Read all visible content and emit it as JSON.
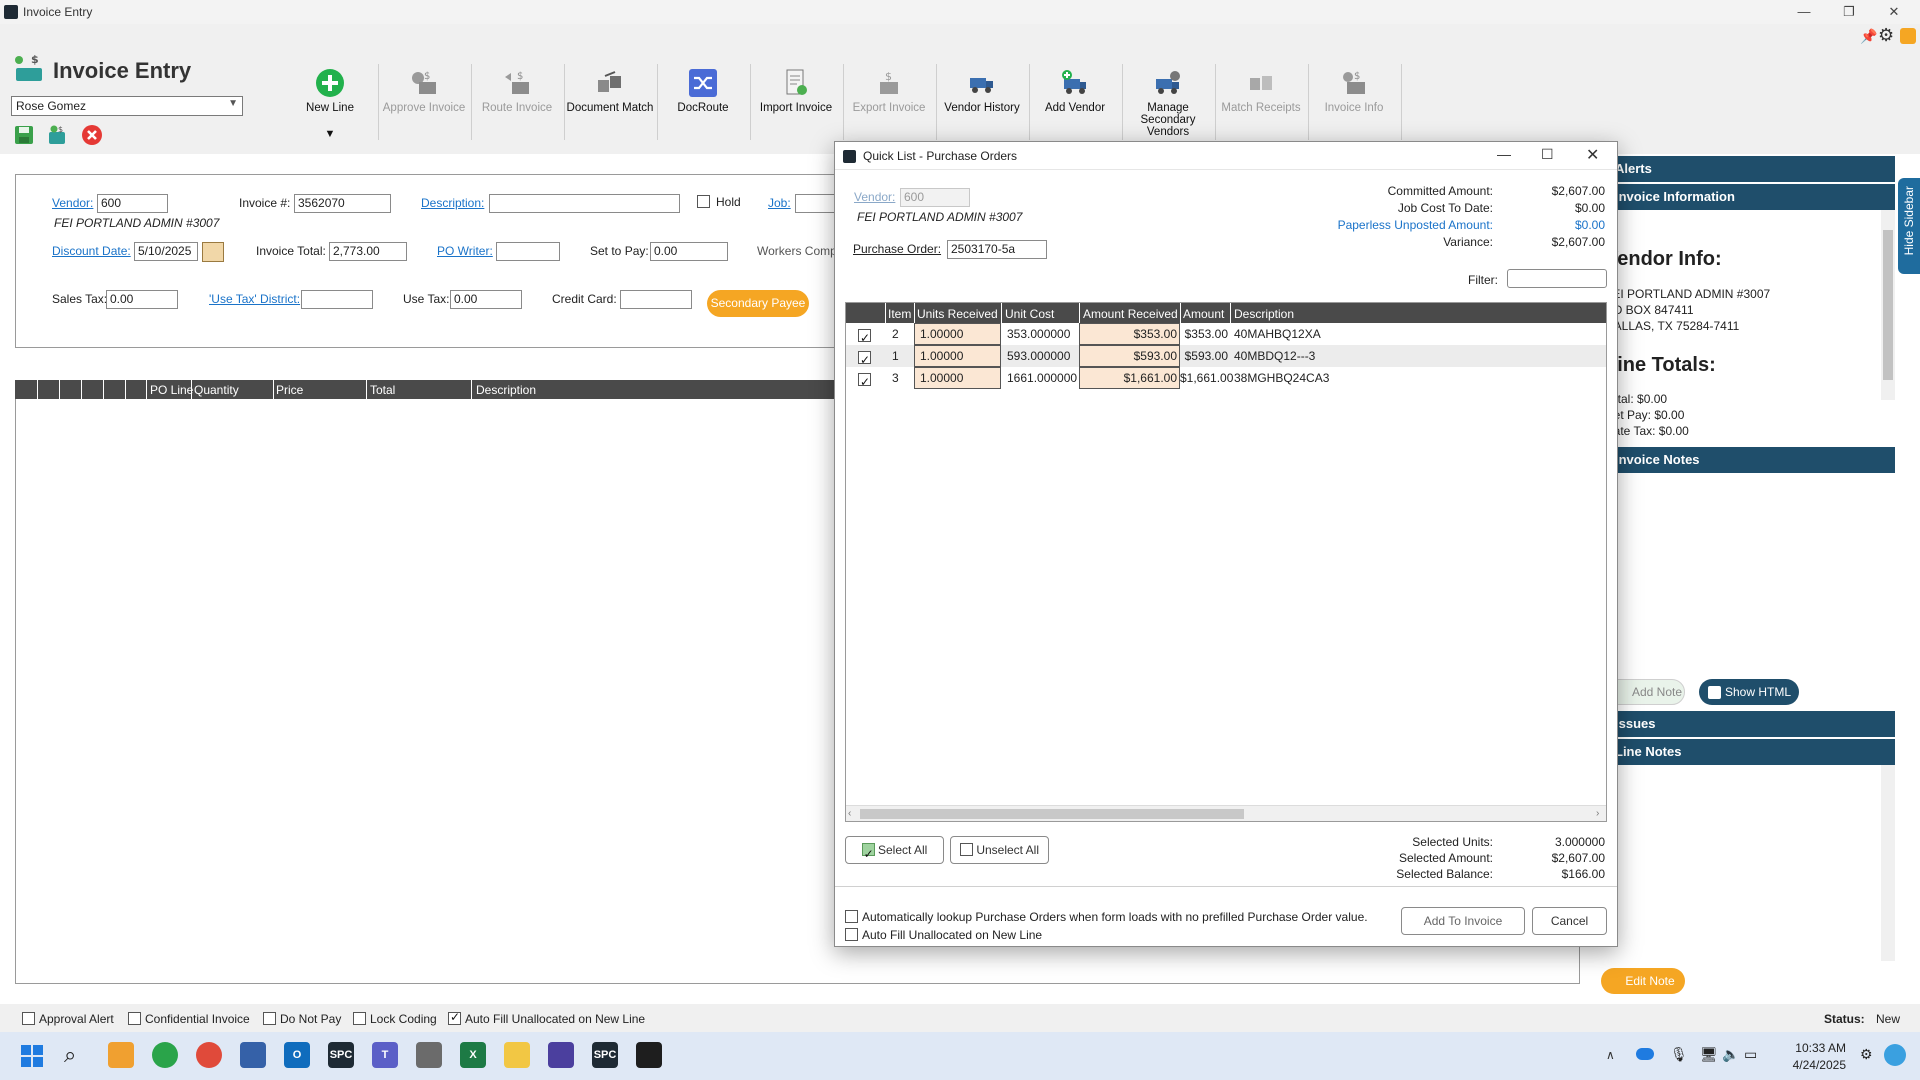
{
  "window": {
    "title": "Invoice Entry"
  },
  "header": {
    "title": "Invoice Entry",
    "user": "Rose Gomez"
  },
  "toolbar": {
    "buttons": [
      {
        "label": "New Line",
        "disabled": false
      },
      {
        "label": "Approve Invoice",
        "disabled": true
      },
      {
        "label": "Route Invoice",
        "disabled": true
      },
      {
        "label": "Document Match",
        "disabled": false
      },
      {
        "label": "DocRoute",
        "disabled": false
      },
      {
        "label": "Import Invoice",
        "disabled": false
      },
      {
        "label": "Export Invoice",
        "disabled": true
      },
      {
        "label": "Vendor History",
        "disabled": false
      },
      {
        "label": "Add Vendor",
        "disabled": false
      },
      {
        "label": "Manage Secondary Vendors",
        "disabled": false
      },
      {
        "label": "Match Receipts",
        "disabled": true
      },
      {
        "label": "Invoice Info",
        "disabled": true
      }
    ]
  },
  "form": {
    "vendor_label": "Vendor:",
    "vendor_value": "600",
    "vendor_name": "FEI PORTLAND ADMIN #3007",
    "invoice_no_label": "Invoice #:",
    "invoice_no_value": "3562070",
    "description_label": "Description:",
    "description_value": "",
    "hold_label": "Hold",
    "job_label": "Job:",
    "discount_date_label": "Discount Date:",
    "discount_date_value": "5/10/2025",
    "invoice_total_label": "Invoice Total:",
    "invoice_total_value": "2,773.00",
    "po_writer_label": "PO Writer:",
    "po_writer_value": "",
    "set_to_pay_label": "Set to Pay:",
    "set_to_pay_value": "0.00",
    "workers_comp_label": "Workers Comp",
    "sales_tax_label": "Sales Tax:",
    "sales_tax_value": "0.00",
    "use_tax_district_label": "'Use Tax' District:",
    "use_tax_district_value": "",
    "use_tax_label": "Use Tax:",
    "use_tax_value": "0.00",
    "credit_card_label": "Credit Card:",
    "credit_card_value": "",
    "secondary_payee_label": "Secondary Payee"
  },
  "grid": {
    "columns": [
      "PO Line",
      "Quantity",
      "Price",
      "Total",
      "Description"
    ]
  },
  "sidebar": {
    "alerts_header": "Alerts",
    "invoice_info_header": "Invoice Information",
    "vendor_info_title": "Vendor Info:",
    "vendor_lines": [
      "FEI PORTLAND ADMIN #3007",
      "PO BOX 847411",
      "DALLAS, TX 75284-7411"
    ],
    "line_totals_title": "Line Totals:",
    "total_line": "Total:  $0.00",
    "net_pay_line": "Net Pay:  $0.00",
    "rate_tax_line": "Rate Tax:  $0.00",
    "invoice_notes_header": "Invoice Notes",
    "add_note_label": "Add Note",
    "show_html_label": "Show HTML",
    "issues_header": "Issues",
    "line_notes_header": "Line Notes",
    "edit_note_label": "Edit Note",
    "hide_sidebar_label": "Hide Sidebar"
  },
  "bottom": {
    "approval_alert": "Approval Alert",
    "confidential_invoice": "Confidential Invoice",
    "do_not_pay": "Do Not Pay",
    "lock_coding": "Lock Coding",
    "auto_fill": "Auto Fill Unallocated on New Line",
    "status_label": "Status:",
    "status_value": "New"
  },
  "dialog": {
    "title": "Quick List - Purchase Orders",
    "vendor_label": "Vendor:",
    "vendor_value": "600",
    "vendor_name": "FEI PORTLAND ADMIN #3007",
    "po_label": "Purchase Order:",
    "po_value": "2503170-5a",
    "summary": {
      "committed_label": "Committed Amount:",
      "committed_value": "$2,607.00",
      "job_cost_label": "Job Cost To Date:",
      "job_cost_value": "$0.00",
      "paperless_label": "Paperless Unposted Amount:",
      "paperless_value": "$0.00",
      "variance_label": "Variance:",
      "variance_value": "$2,607.00"
    },
    "filter_label": "Filter:",
    "filter_value": "",
    "columns": [
      "Item",
      "Units Received",
      "Unit Cost",
      "Amount Received",
      "Amount",
      "Description"
    ],
    "rows": [
      {
        "checked": true,
        "item": "2",
        "units": "1.00000",
        "unit_cost": "353.000000",
        "amount_received": "$353.00",
        "amount": "$353.00",
        "description": "40MAHBQ12XA"
      },
      {
        "checked": true,
        "item": "1",
        "units": "1.00000",
        "unit_cost": "593.000000",
        "amount_received": "$593.00",
        "amount": "$593.00",
        "description": "40MBDQ12---3"
      },
      {
        "checked": true,
        "item": "3",
        "units": "1.00000",
        "unit_cost": "1661.000000",
        "amount_received": "$1,661.00",
        "amount": "$1,661.00",
        "description": "38MGHBQ24CA3"
      }
    ],
    "select_all": "Select All",
    "unselect_all": "Unselect All",
    "selected_units_label": "Selected Units:",
    "selected_units_value": "3.000000",
    "selected_amount_label": "Selected Amount:",
    "selected_amount_value": "$2,607.00",
    "selected_balance_label": "Selected Balance:",
    "selected_balance_value": "$166.00",
    "auto_lookup_label": "Automatically lookup Purchase Orders when form loads with no prefilled Purchase Order value.",
    "auto_fill_label": "Auto Fill Unallocated on New Line",
    "add_to_invoice": "Add To Invoice",
    "cancel": "Cancel"
  },
  "taskbar": {
    "time": "10:33 AM",
    "date": "4/24/2025"
  },
  "colors": {
    "accent_orange": "#f5a623",
    "sidebar_blue": "#1f4e6b",
    "link_blue": "#1a73c9",
    "grid_header": "#4a4a4a",
    "edit_cell": "#fbe7d4"
  }
}
